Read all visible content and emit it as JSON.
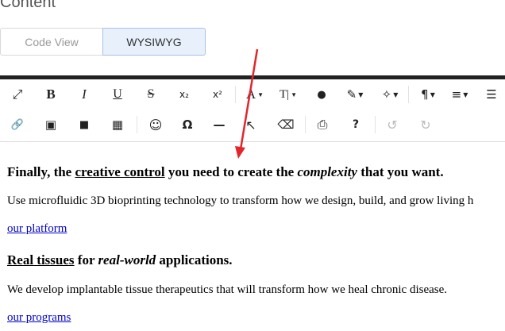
{
  "section": {
    "title": "Content"
  },
  "view_tabs": {
    "code_view": "Code View",
    "wysiwyg": "WYSIWYG"
  },
  "toolbar": {
    "row1": {
      "fullscreen": "⤢",
      "bold": "B",
      "italic": "I",
      "underline": "U",
      "strikethrough": "S",
      "subscript": "x₂",
      "superscript": "x²",
      "font_family": "A",
      "font_size": "T|",
      "color": "●",
      "paint": "✎",
      "magic": "✧",
      "paragraph": "¶",
      "align": "≡",
      "list": "☰"
    },
    "row2": {
      "link": "🔗",
      "image": "▣",
      "video": "■",
      "table": "▦",
      "emoji": "☺",
      "special_char": "Ω",
      "hr": "—",
      "select_all": "↖",
      "clear_format": "⌫",
      "print": "⎙",
      "help": "?",
      "undo": "↺",
      "redo": "↻"
    }
  },
  "content": {
    "heading1": {
      "part1": "Finally, the ",
      "part2": "creative control",
      "part3": " you need to create the ",
      "part4": "complexity",
      "part5": " that you want."
    },
    "paragraph1": "Use microfluidic 3D bioprinting technology to transform how we design, build, and grow living h",
    "link1": "our platform",
    "heading2": {
      "part1": "Real tissues",
      "part2": " for ",
      "part3": "real-world",
      "part4": " applications."
    },
    "paragraph2": "We develop implantable tissue therapeutics that will transform how we heal chronic disease.",
    "link2": "our programs"
  },
  "annotation": {
    "color": "#e3262b"
  }
}
